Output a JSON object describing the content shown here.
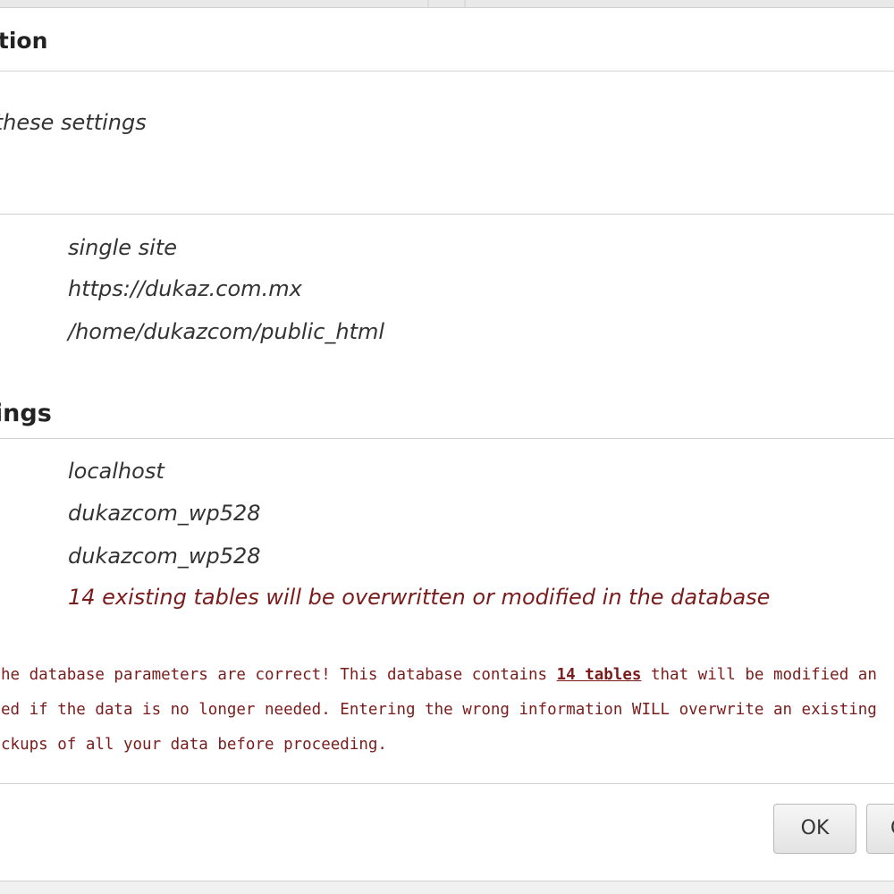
{
  "dialog": {
    "title": "ation",
    "question": "these settings?",
    "site_settings": {
      "install_type": "single site",
      "url": "https://dukaz.com.mx",
      "path": "/home/dukazcom/public_html"
    },
    "db_section_title": "tings",
    "db_settings": {
      "host": "localhost",
      "name": "dukazcom_wp528",
      "user": "dukazcom_wp528",
      "tables_warning": "14 existing tables will be overwritten or modified in the database"
    },
    "notice": {
      "line1_pre": "he database parameters are correct! This database contains ",
      "line1_link": "14 tables",
      "line1_post": " that will be modified and",
      "line2": "ed if the data is no longer needed. Entering the wrong information WILL overwrite an existing da",
      "line3": "ckups of all your data before proceeding."
    },
    "buttons": {
      "ok": "OK",
      "cancel": "C"
    }
  }
}
